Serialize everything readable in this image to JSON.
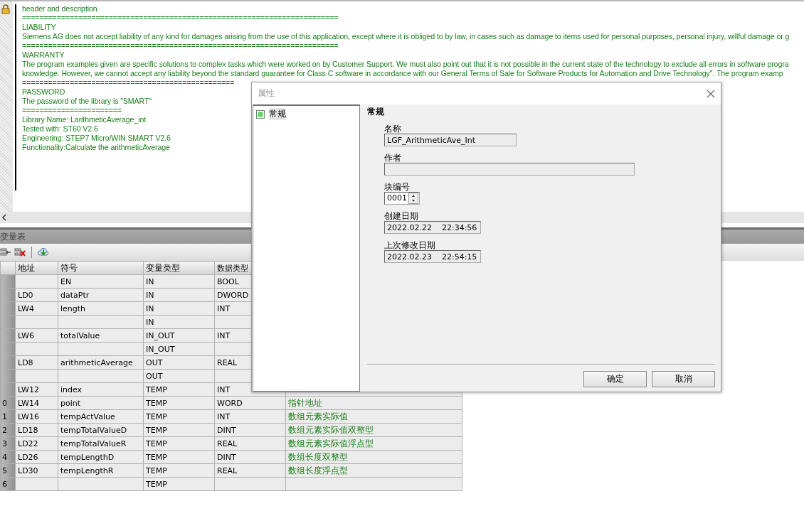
{
  "editor": {
    "lines": [
      "header and description",
      "=========================================================================",
      "LIABILITY",
      "Siemens AG does not accept liability of any kind for damages arising from the use of this application, except where it is obliged to by law, in cases such as damage to items used for personal purposes, personal injury, willful damage or g",
      "=========================================================================",
      "WARRANTY",
      "The program examples given are specific solutions to complex tasks which were worked on by Customer Support. We must also point out that it is not possible in the current state of the technology to exclude all errors in software progra",
      "knowledge. However, we cannot accept any liability beyond the standard guarantee for Class C software in accordance with our General Terms of Sale for Software Products for Automation and Drive Technology\". The program examp",
      "=================================================",
      "PASSWORD",
      "The password of the library is \"SMART\"",
      "=======================",
      "Library Name: LarithmeticAverage_int",
      "Tested with: ST60 V2.6",
      "Engineering: STEP7 Micro/WIN SMART V2.6",
      "Functionality:Calculate the arithmeticAverage"
    ]
  },
  "variable_table": {
    "title": "变量表",
    "columns": [
      "地址",
      "符号",
      "变量类型",
      "数据类型"
    ],
    "rows": [
      {
        "symbol": "EN",
        "var_type": "IN",
        "data_type": "BOOL"
      },
      {
        "address": "LD0",
        "symbol": "dataPtr",
        "var_type": "IN",
        "data_type": "DWORD"
      },
      {
        "address": "LW4",
        "symbol": "length",
        "var_type": "IN",
        "data_type": "INT"
      },
      {
        "var_type": "IN"
      },
      {
        "address": "LW6",
        "symbol": "totalValue",
        "var_type": "IN_OUT",
        "data_type": "INT"
      },
      {
        "var_type": "IN_OUT"
      },
      {
        "address": "LD8",
        "symbol": "arithmeticAverage",
        "var_type": "OUT",
        "data_type": "REAL"
      },
      {
        "var_type": "OUT"
      },
      {
        "address": "LW12",
        "symbol": "index",
        "var_type": "TEMP",
        "data_type": "INT"
      },
      {
        "row_number": "0",
        "address": "LW14",
        "symbol": "point",
        "var_type": "TEMP",
        "data_type": "WORD",
        "comment": "指针地址"
      },
      {
        "row_number": "1",
        "address": "LW16",
        "symbol": "tempActValue",
        "var_type": "TEMP",
        "data_type": "INT",
        "comment": "数组元素实际值"
      },
      {
        "row_number": "2",
        "address": "LD18",
        "symbol": "tempTotalValueD",
        "var_type": "TEMP",
        "data_type": "DINT",
        "comment": "数组元素实际值双整型"
      },
      {
        "row_number": "3",
        "address": "LD22",
        "symbol": "tempTotalValueR",
        "var_type": "TEMP",
        "data_type": "REAL",
        "comment": "数组元素实际值浮点型"
      },
      {
        "row_number": "4",
        "address": "LD26",
        "symbol": "tempLengthD",
        "var_type": "TEMP",
        "data_type": "DINT",
        "comment": "数组长度双整型"
      },
      {
        "row_number": "5",
        "address": "LD30",
        "symbol": "tempLengthR",
        "var_type": "TEMP",
        "data_type": "REAL",
        "comment": "数组长度浮点型"
      },
      {
        "row_number": "6",
        "var_type": "TEMP"
      }
    ]
  },
  "dialog": {
    "title": "属性",
    "tree": [
      {
        "label": "常规",
        "selected": true
      }
    ],
    "heading": "常规",
    "fields": [
      {
        "kind": "short",
        "label": "名称",
        "value": "LGF_ArithmeticAve_Int"
      },
      {
        "kind": "long",
        "label": "作者"
      },
      {
        "kind": "spin",
        "label": "块编号",
        "value": "0001"
      },
      {
        "kind": "date",
        "label": "创建日期",
        "value": "2022.02.22    22:34:56"
      },
      {
        "kind": "date",
        "label": "上次修改日期",
        "value": "2022.02.23    22:54:15"
      }
    ],
    "buttons": [
      "确定",
      "取消"
    ]
  }
}
